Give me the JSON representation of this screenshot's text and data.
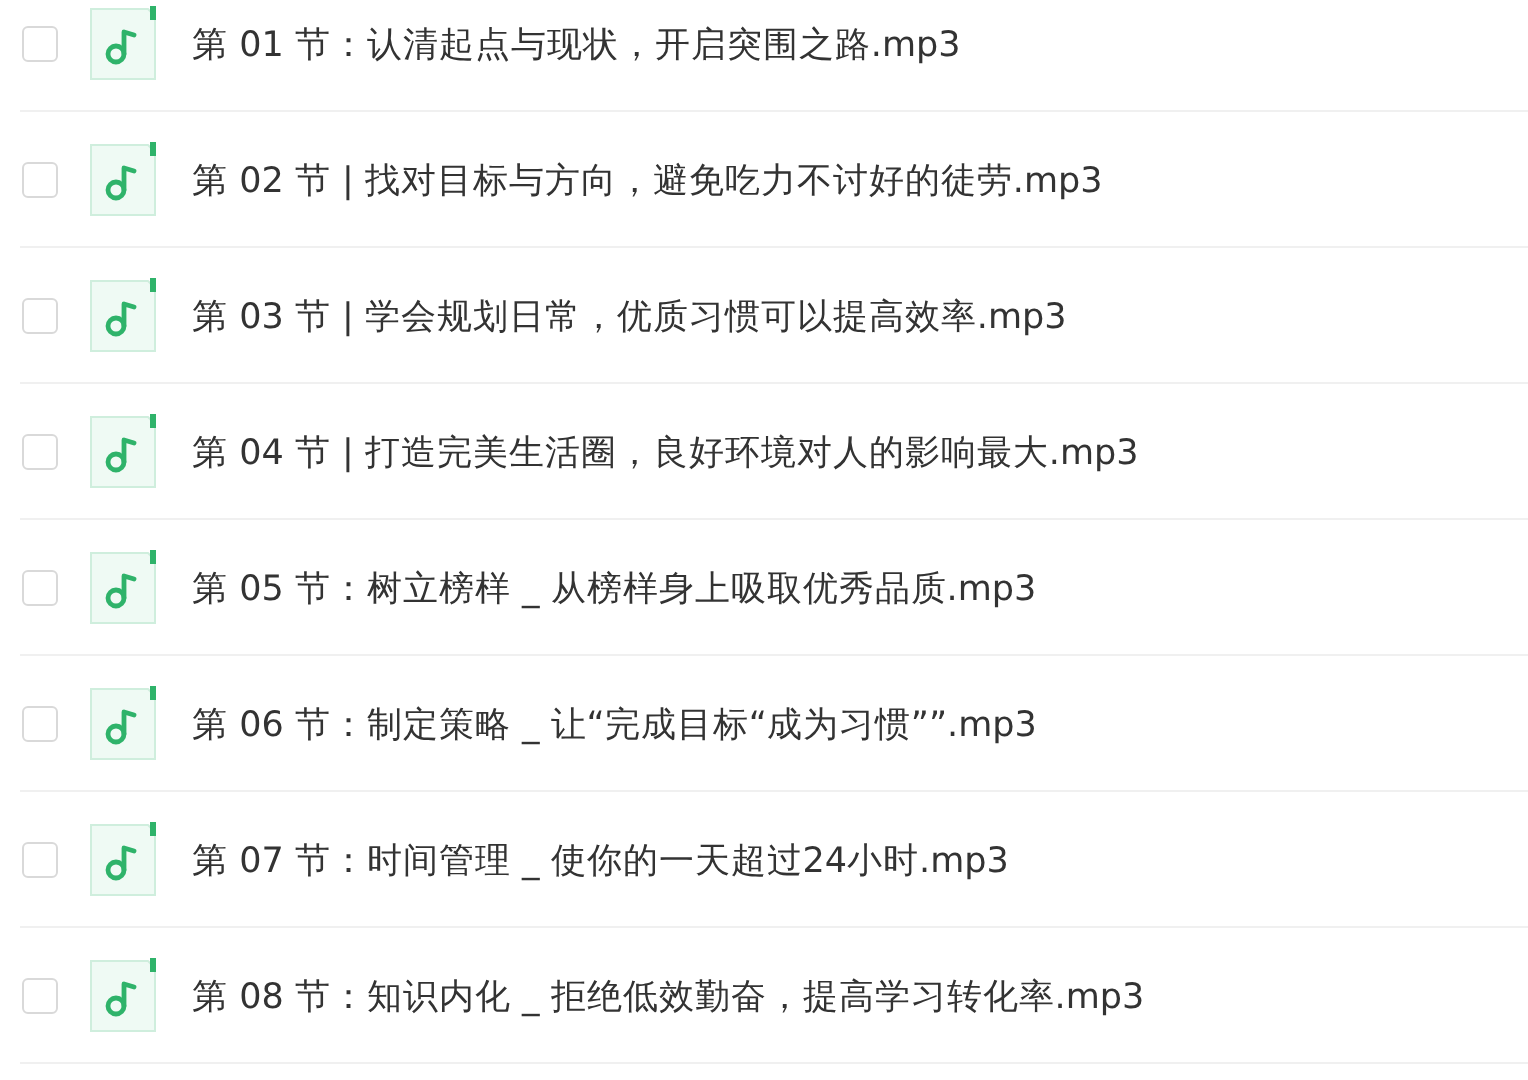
{
  "files": [
    {
      "name": "第 01 节：认清起点与现状，开启突围之路.mp3",
      "checked": false
    },
    {
      "name": "第 02 节 | 找对目标与方向，避免吃力不讨好的徒劳.mp3",
      "checked": false
    },
    {
      "name": "第 03 节 | 学会规划日常，优质习惯可以提高效率.mp3",
      "checked": false
    },
    {
      "name": "第 04 节 | 打造完美生活圈，良好环境对人的影响最大.mp3",
      "checked": false
    },
    {
      "name": "第 05 节：树立榜样 _ 从榜样身上吸取优秀品质.mp3",
      "checked": false
    },
    {
      "name": "第 06 节：制定策略 _ 让“完成目标“成为习惯””.mp3",
      "checked": false
    },
    {
      "name": "第 07 节：时间管理 _ 使你的一天超过24小时.mp3",
      "checked": false
    },
    {
      "name": "第 08 节：知识内化 _ 拒绝低效勤奋，提高学习转化率.mp3",
      "checked": false
    }
  ]
}
